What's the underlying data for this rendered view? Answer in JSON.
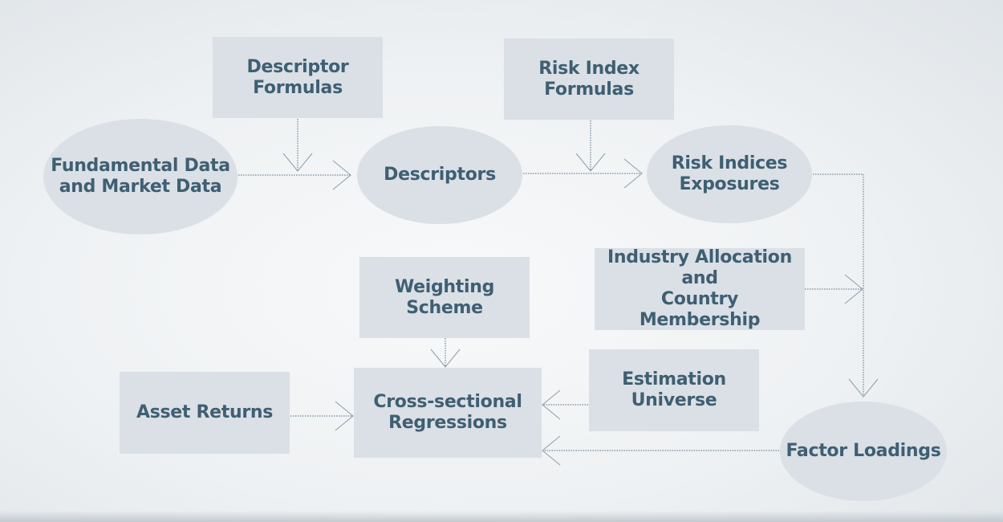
{
  "diagram": {
    "theme": {
      "node_fill": "#dae0e6",
      "text_color": "#3f5f72",
      "line_color": "#6f8597",
      "arrow_color": "#8d9daa"
    },
    "nodes": {
      "fundamental_data": {
        "label": "Fundamental Data\nand Market Data",
        "shape": "ellipse"
      },
      "descriptor_formulas": {
        "label": "Descriptor\nFormulas",
        "shape": "rectangle"
      },
      "descriptors": {
        "label": "Descriptors",
        "shape": "ellipse"
      },
      "risk_index_formulas": {
        "label": "Risk Index\nFormulas",
        "shape": "rectangle"
      },
      "risk_indices_exposures": {
        "label": "Risk Indices\nExposures",
        "shape": "ellipse"
      },
      "industry_country": {
        "label": "Industry Allocation\nand\nCountry Membership",
        "shape": "rectangle"
      },
      "weighting_scheme": {
        "label": "Weighting\nScheme",
        "shape": "rectangle"
      },
      "estimation_universe": {
        "label": "Estimation\nUniverse",
        "shape": "rectangle"
      },
      "asset_returns": {
        "label": "Asset Returns",
        "shape": "rectangle"
      },
      "cross_sectional_regressions": {
        "label": "Cross-sectional\nRegressions",
        "shape": "rectangle"
      },
      "factor_loadings": {
        "label": "Factor Loadings",
        "shape": "ellipse"
      }
    },
    "edges": [
      {
        "from": "fundamental_data",
        "to": "descriptors",
        "style": "dotted"
      },
      {
        "from": "descriptor_formulas",
        "to": "fundamental_data->descriptors",
        "style": "dotted"
      },
      {
        "from": "descriptors",
        "to": "risk_indices_exposures",
        "style": "dotted"
      },
      {
        "from": "risk_index_formulas",
        "to": "descriptors->risk_indices_exposures",
        "style": "dotted"
      },
      {
        "from": "risk_indices_exposures",
        "to": "factor_loadings",
        "style": "dotted"
      },
      {
        "from": "industry_country",
        "to": "risk_indices_exposures->factor_loadings",
        "style": "dotted"
      },
      {
        "from": "weighting_scheme",
        "to": "cross_sectional_regressions",
        "style": "dotted"
      },
      {
        "from": "asset_returns",
        "to": "cross_sectional_regressions",
        "style": "dotted"
      },
      {
        "from": "estimation_universe",
        "to": "cross_sectional_regressions",
        "style": "dotted"
      },
      {
        "from": "factor_loadings",
        "to": "cross_sectional_regressions",
        "style": "dotted"
      }
    ]
  }
}
